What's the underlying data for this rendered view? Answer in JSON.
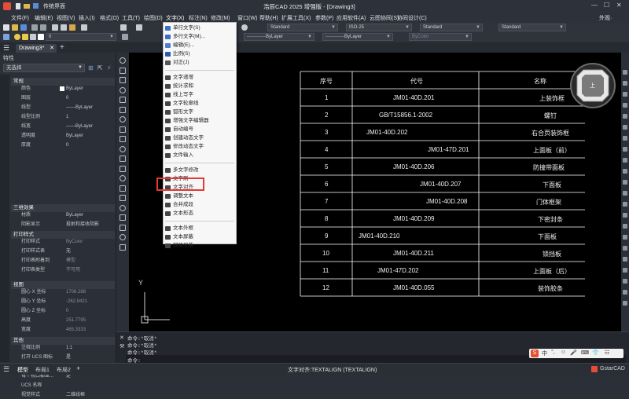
{
  "app": {
    "title": "浩辰CAD 2025 增强版 - [Drawing3]",
    "quick_access_label": "传统界面",
    "workspace_label": "外观·",
    "doc_tab": "Drawing3*"
  },
  "menubar": {
    "items": [
      "文件(F)",
      "编辑(E)",
      "视图(V)",
      "插入(I)",
      "格式(O)",
      "工具(T)",
      "绘图(D)",
      "文字(X)",
      "标注(N)",
      "修改(M)",
      "窗口(W)",
      "帮助(H)",
      "扩展工具(X)",
      "参数(P)",
      "应用软件(A)",
      "云图协同(S)",
      "协同设计(C)"
    ]
  },
  "toolbar": {
    "text_style": "Standard",
    "dim_style": "ISO-25",
    "table_style": "Standard",
    "multileader_style": "Standard",
    "layer": "ByLayer",
    "linetype": "ByLayer",
    "lineweight": "ByLayer",
    "plotstyle": "ByColor"
  },
  "properties": {
    "header": "特性",
    "selection": "无选择",
    "sections": [
      {
        "title": "常规",
        "rows": [
          {
            "k": "颜色",
            "v": "ByLayer"
          },
          {
            "k": "图层",
            "v": "0"
          },
          {
            "k": "线型",
            "v": "——ByLayer"
          },
          {
            "k": "线型比例",
            "v": "1"
          },
          {
            "k": "线宽",
            "v": "——ByLayer"
          },
          {
            "k": "透明度",
            "v": "ByLayer"
          },
          {
            "k": "厚度",
            "v": "0"
          }
        ]
      },
      {
        "title": "三维效果",
        "rows": [
          {
            "k": "材质",
            "v": "ByLayer"
          },
          {
            "k": "阴影显示",
            "v": "投射和接收阴影"
          }
        ]
      },
      {
        "title": "打印样式",
        "rows": [
          {
            "k": "打印样式",
            "v": "ByColor"
          },
          {
            "k": "打印样式表",
            "v": "无"
          },
          {
            "k": "打印表附着到",
            "v": "模型"
          },
          {
            "k": "打印表类型",
            "v": "不可用"
          }
        ]
      },
      {
        "title": "视图",
        "rows": [
          {
            "k": "圆心 X 坐标",
            "v": "1708.288"
          },
          {
            "k": "圆心 Y 坐标",
            "v": "-262.9421"
          },
          {
            "k": "圆心 Z 坐标",
            "v": "0"
          },
          {
            "k": "高度",
            "v": "251.7795"
          },
          {
            "k": "宽度",
            "v": "465.3333"
          }
        ]
      },
      {
        "title": "其他",
        "rows": [
          {
            "k": "注释比例",
            "v": "1:1"
          },
          {
            "k": "打开 UCS 图标",
            "v": "是"
          },
          {
            "k": "在原点显示 UC...",
            "v": "是"
          },
          {
            "k": "每个视口都显...",
            "v": "是"
          },
          {
            "k": "UCS 名称",
            "v": ""
          },
          {
            "k": "视觉样式",
            "v": "二维线框"
          }
        ]
      }
    ]
  },
  "text_menu": {
    "items": [
      "单行文字(S)",
      "多行文字(M)...",
      "编辑(E)...",
      "比例(S)",
      "对正(J)",
      "文字递增",
      "统计求和",
      "线上写字",
      "文字轮廓线",
      "弧形文字",
      "增强文字编辑器",
      "自动编号",
      "创建动态文字",
      "修改动态文字",
      "文件输入",
      "多文字修改",
      "文字刷",
      "文字对齐",
      "调整文本",
      "合并成段",
      "文本形态",
      "文本外框",
      "文本屏蔽",
      "解除屏蔽"
    ],
    "highlighted": "文字对齐"
  },
  "drawing_table": {
    "headers": [
      "序号",
      "代号",
      "名称"
    ],
    "rows": [
      {
        "no": "1",
        "code": "JM01-40D.201",
        "name": "上装饰框"
      },
      {
        "no": "2",
        "code": "GB/T15856.1-2002",
        "name": "螺钉"
      },
      {
        "no": "3",
        "code": "JM01-40D.202",
        "name": "右合页装饰框"
      },
      {
        "no": "4",
        "code": "JM01-47D.201",
        "name": "上面板（前）"
      },
      {
        "no": "5",
        "code": "JM01-40D.206",
        "name": "防撞带面板"
      },
      {
        "no": "6",
        "code": "JM01-40D.207",
        "name": "下面板"
      },
      {
        "no": "7",
        "code": "JM01-40D.208",
        "name": "门体框架"
      },
      {
        "no": "8",
        "code": "JM01-40D.209",
        "name": "下密封条"
      },
      {
        "no": "9",
        "code": "JM01-40D.210",
        "name": "下面板"
      },
      {
        "no": "10",
        "code": "JM01-40D.211",
        "name": "锁挡板"
      },
      {
        "no": "11",
        "code": "JM01-47D.202",
        "name": "上面板（后）"
      },
      {
        "no": "12",
        "code": "JM01-40D.055",
        "name": "装饰胶条"
      }
    ]
  },
  "viewcube": {
    "label": "上"
  },
  "ucs": {
    "y": "Y"
  },
  "command": {
    "lines": [
      "命令:*取消*",
      "命令:*取消*",
      "命令:*取消*"
    ],
    "prompt": "命令:"
  },
  "status": {
    "tabs": [
      "模型",
      "布局1",
      "布局2"
    ],
    "message": "文字对齐:TEXTALIGN (TEXTALIGN)",
    "brand": "GstarCAD"
  }
}
